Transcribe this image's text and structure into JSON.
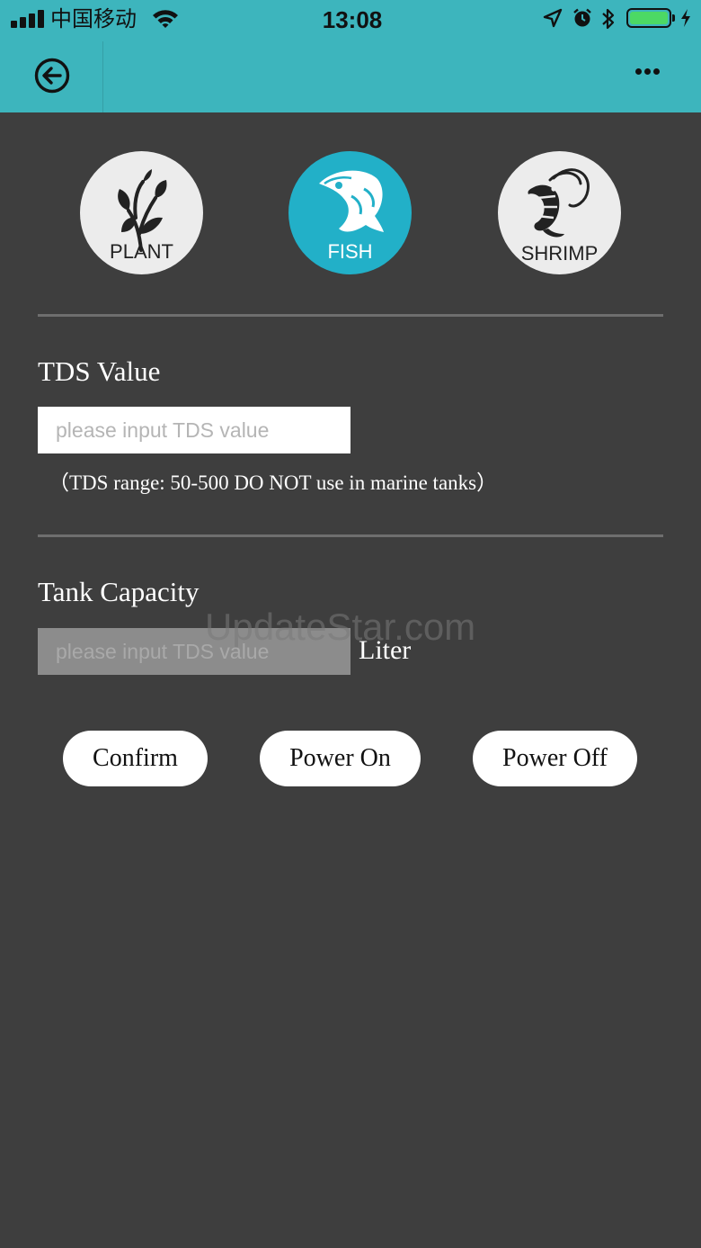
{
  "status_bar": {
    "carrier": "中国移动",
    "time": "13:08"
  },
  "header": {
    "back_icon": "back-arrow-circle-icon",
    "menu_icon": "more-dots-icon",
    "accent_color": "#3db5bd"
  },
  "modes": [
    {
      "label": "PLANT",
      "icon": "plant-icon",
      "active": false
    },
    {
      "label": "FISH",
      "icon": "fish-icon",
      "active": true
    },
    {
      "label": "SHRIMP",
      "icon": "shrimp-icon",
      "active": false
    }
  ],
  "tds": {
    "title": "TDS Value",
    "placeholder": "please input TDS value",
    "value": "",
    "hint": "（TDS range: 50-500 DO NOT use in marine tanks）"
  },
  "tank": {
    "title": "Tank Capacity",
    "placeholder": "please input TDS value",
    "value": "",
    "unit": "Liter"
  },
  "watermark": "UpdateStar.com",
  "actions": {
    "confirm": "Confirm",
    "power_on": "Power On",
    "power_off": "Power Off"
  },
  "colors": {
    "background": "#3e3e3e",
    "active_mode": "#22b0c8",
    "battery": "#4cd964"
  }
}
